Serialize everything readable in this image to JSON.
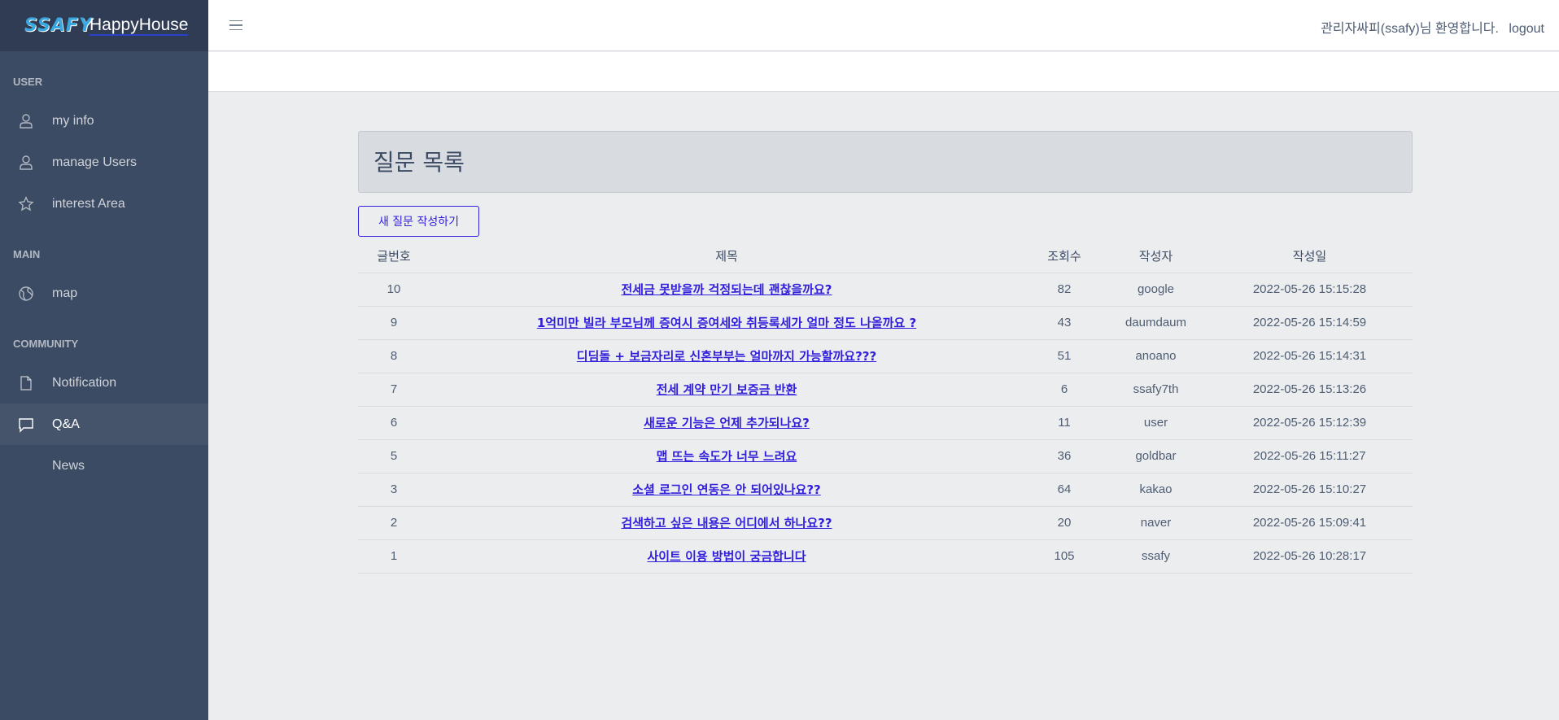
{
  "brand": {
    "logo": "SSAFY",
    "name": "HappyHouse"
  },
  "sidebar": {
    "sections": [
      {
        "title": "USER",
        "items": [
          {
            "label": "my info",
            "icon": "user-icon"
          },
          {
            "label": "manage Users",
            "icon": "user-icon"
          },
          {
            "label": "interest Area",
            "icon": "star-icon"
          }
        ]
      },
      {
        "title": "MAIN",
        "items": [
          {
            "label": "map",
            "icon": "globe-icon"
          }
        ]
      },
      {
        "title": "COMMUNITY",
        "items": [
          {
            "label": "Notification",
            "icon": "file-icon"
          },
          {
            "label": "Q&A",
            "icon": "speech-icon",
            "active": true
          },
          {
            "label": "News",
            "icon": ""
          }
        ]
      }
    ]
  },
  "header": {
    "greeting": "관리자싸피(ssafy)님 환영합니다.",
    "logout": "logout"
  },
  "main": {
    "title": "질문 목록",
    "new_button": "새 질문 작성하기",
    "columns": [
      "글번호",
      "제목",
      "조회수",
      "작성자",
      "작성일"
    ],
    "rows": [
      {
        "no": "10",
        "title": "전세금 못받을까 걱정되는데 괜찮을까요?",
        "views": "82",
        "author": "google",
        "date": "2022-05-26 15:15:28"
      },
      {
        "no": "9",
        "title": "1억미만 빌라 부모님께 증여시 증여세와 취등록세가 얼마 정도 나올까요 ?",
        "views": "43",
        "author": "daumdaum",
        "date": "2022-05-26 15:14:59"
      },
      {
        "no": "8",
        "title": "디딤돌 + 보금자리로 신혼부부는 얼마까지 가능할까요???",
        "views": "51",
        "author": "anoano",
        "date": "2022-05-26 15:14:31"
      },
      {
        "no": "7",
        "title": "전세 계약 만기 보증금 반환",
        "views": "6",
        "author": "ssafy7th",
        "date": "2022-05-26 15:13:26"
      },
      {
        "no": "6",
        "title": "새로운 기능은 언제 추가되나요?",
        "views": "11",
        "author": "user",
        "date": "2022-05-26 15:12:39"
      },
      {
        "no": "5",
        "title": "맵 뜨는 속도가 너무 느려요",
        "views": "36",
        "author": "goldbar",
        "date": "2022-05-26 15:11:27"
      },
      {
        "no": "3",
        "title": "소셜 로그인 연동은 안 되어있나요??",
        "views": "64",
        "author": "kakao",
        "date": "2022-05-26 15:10:27"
      },
      {
        "no": "2",
        "title": "검색하고 싶은 내용은 어디에서 하나요??",
        "views": "20",
        "author": "naver",
        "date": "2022-05-26 15:09:41"
      },
      {
        "no": "1",
        "title": "사이트 이용 방법이 궁금합니다",
        "views": "105",
        "author": "ssafy",
        "date": "2022-05-26 10:28:17"
      }
    ]
  },
  "colors": {
    "sidebar": "#3c4b64",
    "brand_bg": "#303c54",
    "primary": "#321fdb",
    "body_bg": "#ebedef"
  }
}
